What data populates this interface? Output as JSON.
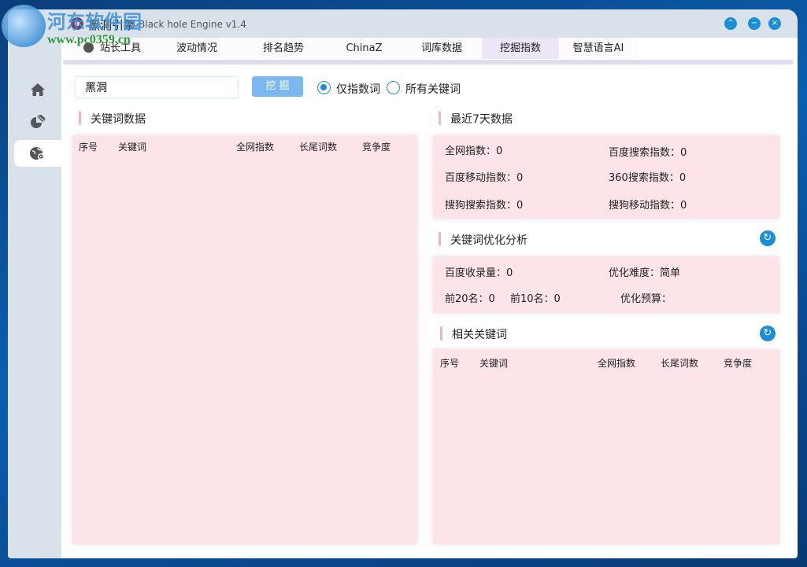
{
  "watermark": {
    "name": "河东软件园",
    "url": "www.pc0359.cn"
  },
  "window": {
    "title_cn": "黑洞引擎",
    "title_en": "Black hole Engine v1.4",
    "controls": [
      "collapse",
      "minimize",
      "close"
    ]
  },
  "tabs": [
    {
      "label": "站长工具",
      "icon": "globe-gear-icon"
    },
    {
      "label": "波动情况"
    },
    {
      "label": "排名趋势"
    },
    {
      "label": "ChinaZ"
    },
    {
      "label": "词库数据"
    },
    {
      "label": "挖掘指数",
      "active": true
    },
    {
      "label": "智慧语言AI"
    }
  ],
  "sidebar": {
    "items": [
      {
        "icon": "home-icon"
      },
      {
        "icon": "pie-chart-icon"
      },
      {
        "icon": "globe-gear-icon",
        "active": true
      }
    ]
  },
  "search": {
    "value": "黑洞",
    "button": "挖 掘"
  },
  "mode": {
    "options": [
      "仅指数词",
      "所有关键词"
    ],
    "selected": "仅指数词"
  },
  "keyword_data": {
    "title": "关键词数据",
    "columns": [
      "序号",
      "关键词",
      "全网指数",
      "长尾词数",
      "竞争度"
    ],
    "rows": []
  },
  "recent7": {
    "title": "最近7天数据",
    "items": [
      "全网指数：0",
      "百度搜索指数：0",
      "百度移动指数：0",
      "360搜索指数：0",
      "搜狗搜索指数：0",
      "搜狗移动指数：0"
    ]
  },
  "optimize": {
    "title": "关键词优化分析",
    "baidu_index": "百度收录量：0",
    "difficulty": "优化难度：简单",
    "top20": "前20名：0",
    "top10": "前10名：0",
    "budget": "优化预算："
  },
  "related": {
    "title": "相关关键词",
    "columns": [
      "序号",
      "关键词",
      "全网指数",
      "长尾词数",
      "竞争度"
    ],
    "rows": []
  },
  "colors": {
    "accent": "#1a8fd8",
    "panel": "#fde4e8",
    "chrome": "#d9e2ea",
    "button": "#7ab8ef"
  }
}
